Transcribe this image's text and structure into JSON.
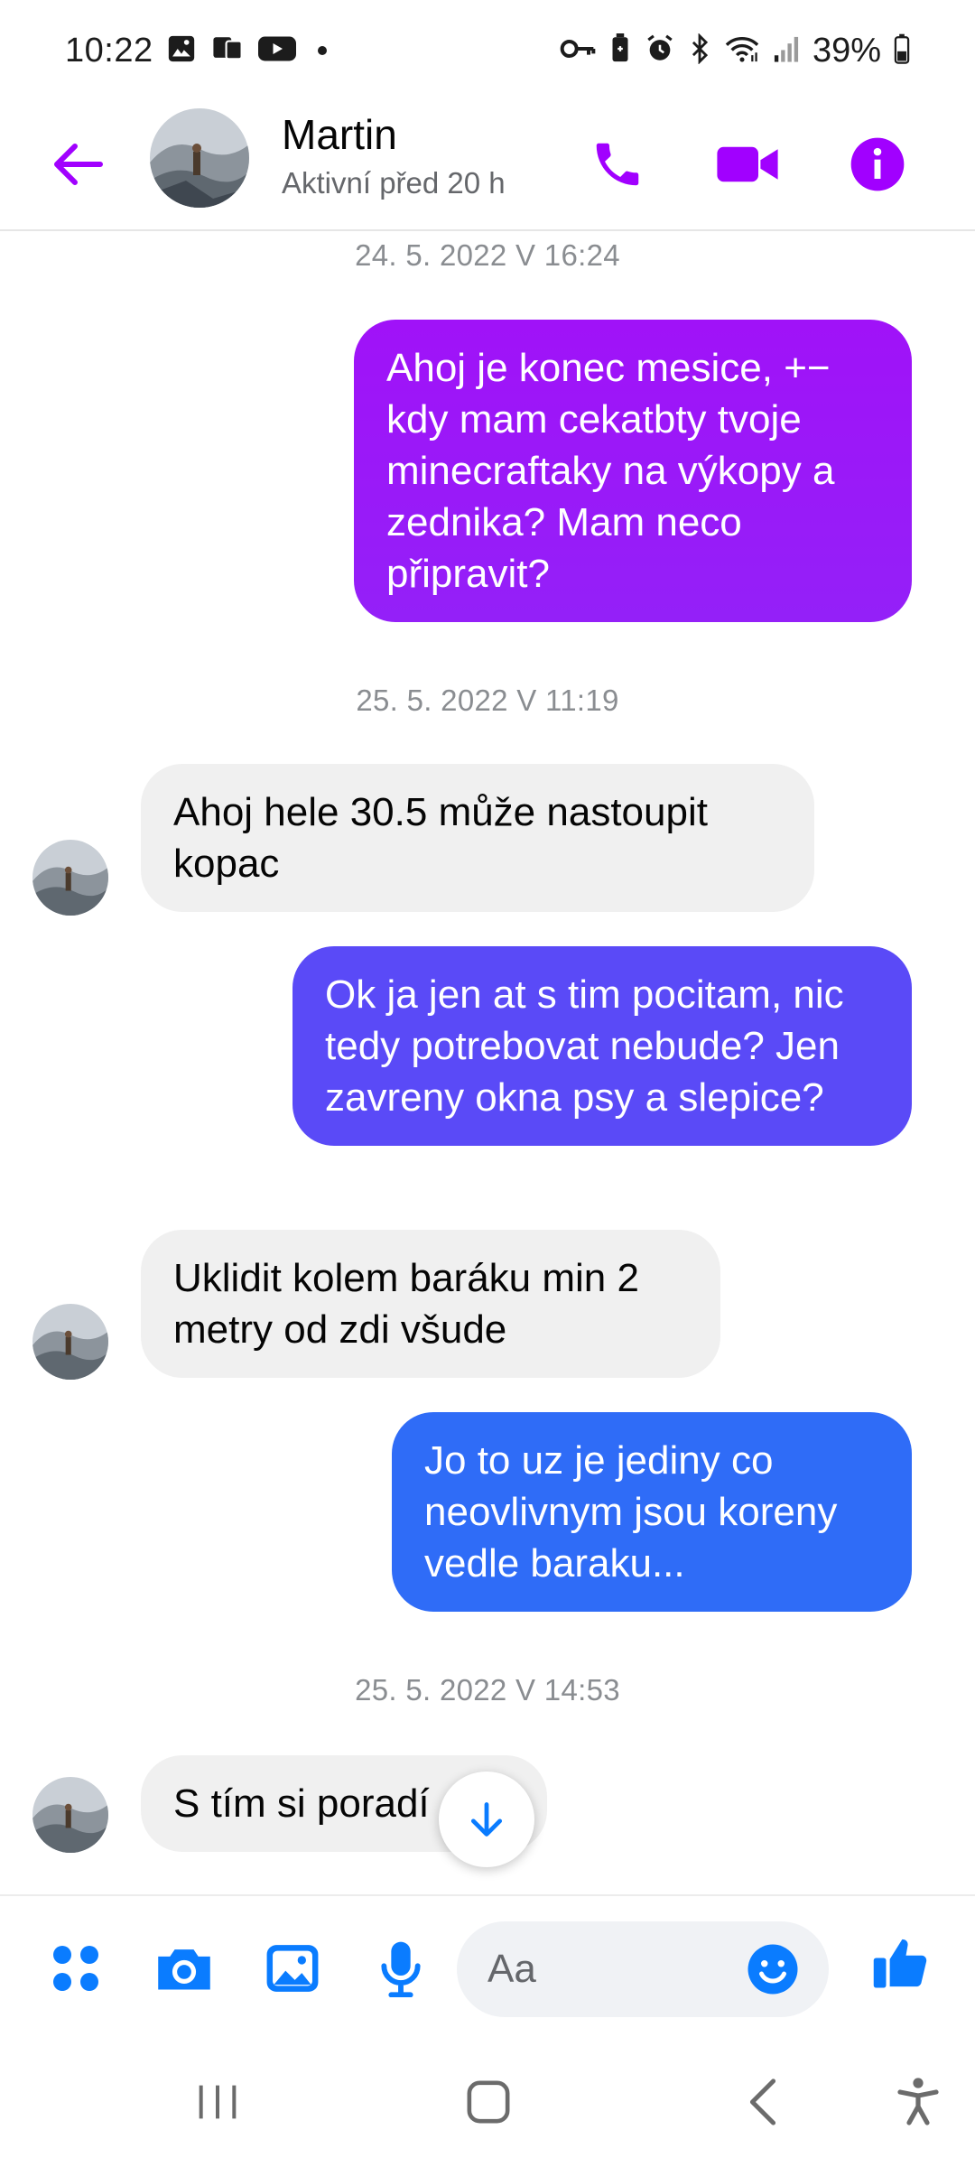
{
  "status_bar": {
    "time": "10:22",
    "battery": "39%",
    "left_icons": [
      "gallery-icon",
      "cast-icon",
      "youtube-icon"
    ],
    "right_icons": [
      "vpn-key-icon",
      "battery-saver-icon",
      "alarm-icon",
      "bluetooth-icon",
      "wifi-icon",
      "signal-icon"
    ]
  },
  "header": {
    "name": "Martin",
    "status": "Aktivní před 20 h",
    "accent_color": "#a100ff"
  },
  "messages": [
    {
      "type": "timestamp",
      "text": "24. 5. 2022 V 16:24"
    },
    {
      "type": "outgoing",
      "text": "Ahoj je konec mesice, +− kdy mam cekatbty tvoje minecraftaky na výkopy a zednika? Mam neco připravit?",
      "color": "#9e16f7"
    },
    {
      "type": "timestamp",
      "text": "25. 5. 2022 V 11:19"
    },
    {
      "type": "incoming",
      "text": "Ahoj hele 30.5 může nastoupit kopac"
    },
    {
      "type": "outgoing",
      "text": "Ok ja jen at s tim pocitam, nic tedy potrebovat nebude? Jen zavreny okna psy a slepice?",
      "color": "#5a4af7"
    },
    {
      "type": "incoming",
      "text": "Uklidit kolem baráku min 2 metry od zdi všude"
    },
    {
      "type": "outgoing",
      "text": "Jo to uz je jediny co neovlivnym jsou koreny vedle baraku...",
      "color": "#2f6cf7"
    },
    {
      "type": "timestamp",
      "text": "25. 5. 2022 V 14:53"
    },
    {
      "type": "incoming",
      "text": "S tím si poradí"
    }
  ],
  "composer": {
    "placeholder": "Aa",
    "icons": [
      "menu-grid-icon",
      "camera-icon",
      "gallery-icon",
      "microphone-icon",
      "emoji-icon",
      "thumbs-up-icon"
    ],
    "accent_color": "#0a7cff"
  },
  "nav_bar": {
    "icons": [
      "recents-icon",
      "home-icon",
      "back-icon",
      "accessibility-icon"
    ]
  }
}
